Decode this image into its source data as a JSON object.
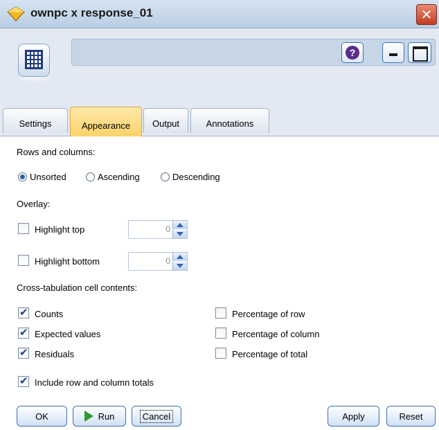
{
  "window": {
    "title": "ownpc x response_01",
    "close_symbol": "✕"
  },
  "header": {
    "help_symbol": "?"
  },
  "tabs": [
    {
      "label": "Settings",
      "active": false
    },
    {
      "label": "Appearance",
      "active": true
    },
    {
      "label": "Output",
      "active": false
    },
    {
      "label": "Annotations",
      "active": false
    }
  ],
  "appearance": {
    "rows_columns_label": "Rows and columns:",
    "sort_options": [
      {
        "label": "Unsorted",
        "selected": true
      },
      {
        "label": "Ascending",
        "selected": false
      },
      {
        "label": "Descending",
        "selected": false
      }
    ],
    "overlay_label": "Overlay:",
    "highlight_top": {
      "label": "Highlight top",
      "checked": false,
      "value": "0"
    },
    "highlight_bottom": {
      "label": "Highlight bottom",
      "checked": false,
      "value": "0"
    },
    "cell_contents_label": "Cross-tabulation cell contents:",
    "cell_contents": [
      {
        "label": "Counts",
        "checked": true
      },
      {
        "label": "Expected values",
        "checked": true
      },
      {
        "label": "Residuals",
        "checked": true
      },
      {
        "label": "Percentage of row",
        "checked": false
      },
      {
        "label": "Percentage of column",
        "checked": false
      },
      {
        "label": "Percentage of total",
        "checked": false
      }
    ],
    "include_totals": {
      "label": "Include row and column totals",
      "checked": true
    }
  },
  "buttons": {
    "ok": "OK",
    "run": "Run",
    "cancel": "Cancel",
    "apply": "Apply",
    "reset": "Reset"
  },
  "colors": {
    "accent": "#2a5fb0",
    "active_tab": "#fbd26a",
    "header_bg": "#e3e9f2"
  }
}
